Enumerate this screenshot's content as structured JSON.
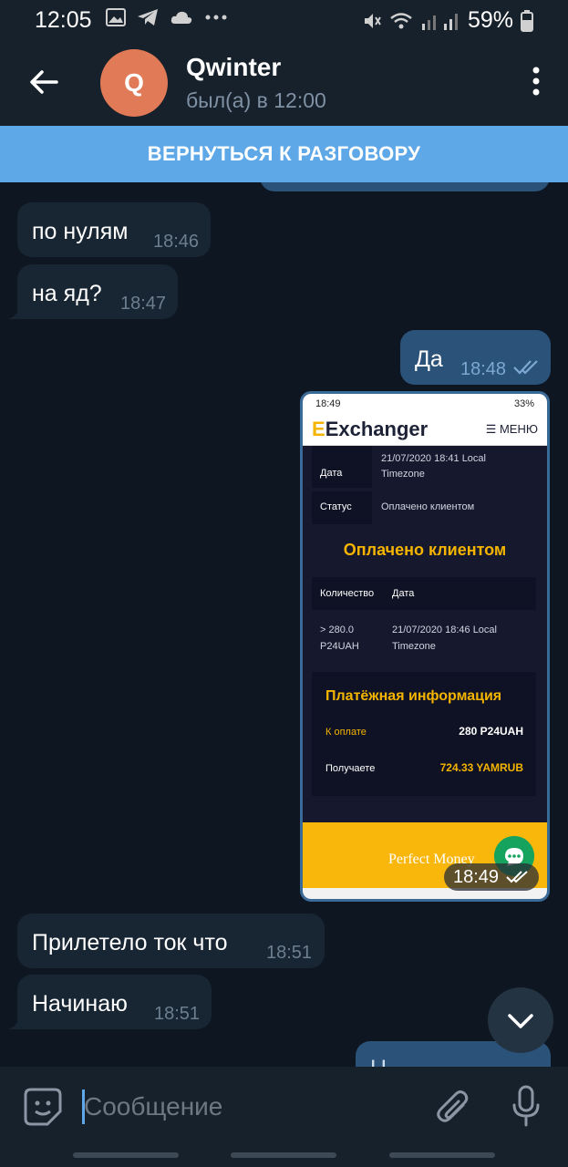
{
  "status_bar": {
    "time": "12:05",
    "battery": "59%",
    "icons": [
      "image-icon",
      "telegram-icon",
      "cloud-icon",
      "more-dots-icon",
      "mute-icon",
      "wifi-icon",
      "signal-icon",
      "battery-icon"
    ]
  },
  "header": {
    "avatar_letter": "Q",
    "name": "Qwinter",
    "status": "был(а) в 12:00"
  },
  "banner": {
    "label": "ВЕРНУТЬСЯ К РАЗГОВОРУ"
  },
  "messages": [
    {
      "dir": "in",
      "text": "по нулям",
      "time": "18:46"
    },
    {
      "dir": "in",
      "text": "на яд?",
      "time": "18:47"
    },
    {
      "dir": "out",
      "text": "Да",
      "time": "18:48"
    },
    {
      "dir": "out_photo",
      "time": "18:49"
    },
    {
      "dir": "in",
      "text": "Прилетело ток что",
      "time": "18:51"
    },
    {
      "dir": "in",
      "text": "Начинаю",
      "time": "18:51"
    },
    {
      "dir": "out",
      "text": "Н...",
      "time": ""
    }
  ],
  "photo": {
    "status_time": "18:49",
    "status_battery": "33%",
    "logo_first": "E",
    "logo_rest": "Exchanger",
    "menu": "МЕНЮ",
    "date_label": "Дата",
    "date_value": "21/07/2020 18:41 Local Timezone",
    "status_label": "Статус",
    "status_value": "Оплачено клиентом",
    "headline": "Оплачено клиентом",
    "table_head_qty": "Количество",
    "table_head_date": "Дата",
    "table_qty": "> 280.0 P24UAH",
    "table_date": "21/07/2020 18:46 Local Timezone",
    "pay_title": "Платёжная информация",
    "to_pay_label": "К оплате",
    "to_pay_value": "280 P24UAH",
    "receive_label": "Получаете",
    "receive_value": "724.33 YAMRUB",
    "footer_brand": "Perfect Money",
    "time": "18:49"
  },
  "input": {
    "placeholder": "Сообщение"
  },
  "colors": {
    "bg": "#0e1621",
    "bar": "#17212b",
    "banner": "#5fa8e8",
    "incoming": "#182533",
    "outgoing": "#2b5278",
    "accent": "#f4b400"
  }
}
